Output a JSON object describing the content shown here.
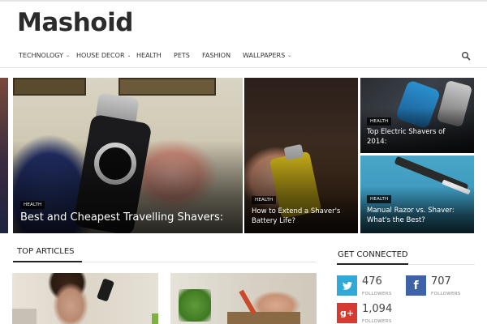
{
  "site": {
    "logo": "Mashoid"
  },
  "nav": {
    "items": [
      {
        "label": "TECHNOLOGY",
        "dropdown": true
      },
      {
        "label": "HOUSE DECOR",
        "dropdown": true
      },
      {
        "label": "HEALTH",
        "dropdown": false
      },
      {
        "label": "PETS",
        "dropdown": false
      },
      {
        "label": "FASHION",
        "dropdown": false
      },
      {
        "label": "WALLPAPERS",
        "dropdown": true
      }
    ],
    "search_icon": "search-icon"
  },
  "hero": {
    "main": {
      "tag": "HEALTH",
      "title": "Best and Cheapest Travelling Shavers:"
    },
    "middle": {
      "tag": "HEALTH",
      "title_line1": "How to Extend a Shaver's",
      "title_line2": "Battery Life?"
    },
    "top_right": {
      "tag": "HEALTH",
      "title_line1": "Top Electric Shavers of",
      "title_line2": "2014:"
    },
    "bottom_right": {
      "tag": "HEALTH",
      "title_line1": "Manual Razor vs. Shaver:",
      "title_line2": "What's the Best?"
    }
  },
  "top_articles": {
    "heading": "TOP ARTICLES"
  },
  "get_connected": {
    "heading": "GET CONNECTED",
    "twitter": {
      "count": "476",
      "label": "FOLLOWERS",
      "color": "#2fa9d7"
    },
    "facebook": {
      "count": "707",
      "label": "FOLLOWERS",
      "color": "#3d62a8"
    },
    "googleplus": {
      "count": "1,094",
      "label": "FOLLOWERS",
      "color": "#d63b32"
    }
  },
  "colors": {
    "accent_text": "#222222",
    "divider": "#e3e3e3"
  }
}
